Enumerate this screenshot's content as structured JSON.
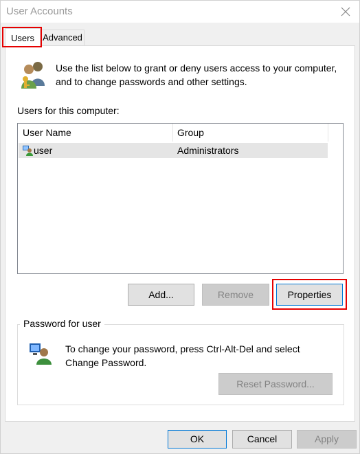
{
  "window": {
    "title": "User Accounts"
  },
  "tabs": [
    {
      "label": "Users",
      "selected": true
    },
    {
      "label": "Advanced",
      "selected": false
    }
  ],
  "users_tab": {
    "intro_text": "Use the list below to grant or deny users access to your computer, and to change passwords and other settings.",
    "list_label": "Users for this computer:",
    "columns": [
      "User Name",
      "Group"
    ],
    "rows": [
      {
        "user_name": "user",
        "group": "Administrators"
      }
    ],
    "buttons": {
      "add": "Add...",
      "remove": "Remove",
      "properties": "Properties"
    }
  },
  "password_group": {
    "title": "Password for user",
    "text": "To change your password, press Ctrl-Alt-Del and select Change Password.",
    "reset_button": "Reset Password..."
  },
  "dialog_buttons": {
    "ok": "OK",
    "cancel": "Cancel",
    "apply": "Apply"
  },
  "colors": {
    "highlight": "#e60000",
    "focus_border": "#0078d7",
    "selected_row": "#e5e5e5"
  }
}
